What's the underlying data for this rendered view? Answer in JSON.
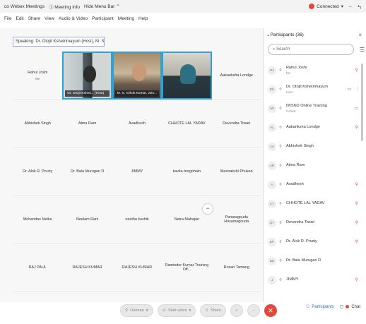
{
  "titlebar": {
    "app_name": "co Webex Meetings",
    "meeting_info": "ⓘ Meeting Info",
    "hide_menu": "Hide Menu Bar ⌃",
    "connected": "Connected",
    "conn_chevron": "▾",
    "minimize": "–",
    "restore": "ㄣ"
  },
  "menubar": [
    "File",
    "Edit",
    "Share",
    "View",
    "Audio & Video",
    "Participant",
    "Meeting",
    "Help"
  ],
  "speaking": "Speaking: Dr. Otojit Kshetrimayum (Host), M. S. Asho...",
  "grid": [
    [
      {
        "type": "text",
        "name": "Rahul Joshi",
        "sub": "Me"
      },
      {
        "type": "video",
        "label": "Dr. Otojit Ksheti... (Host)"
      },
      {
        "type": "video",
        "label": "M. S. Ashok Kumar, Join..."
      },
      {
        "type": "video",
        "label": ""
      },
      {
        "type": "text",
        "name": "Aakanksha Londge",
        "sub": ""
      }
    ],
    [
      {
        "type": "text",
        "name": "Abhishek Singh",
        "sub": ""
      },
      {
        "type": "text",
        "name": "Atma Ram",
        "sub": ""
      },
      {
        "type": "text",
        "name": "Avadhesh",
        "sub": ""
      },
      {
        "type": "text",
        "name": "CHHOTE LAL YADAV",
        "sub": ""
      },
      {
        "type": "text",
        "name": "Devendra Tiwari",
        "sub": ""
      }
    ],
    [
      {
        "type": "text",
        "name": "Dr. Alok R. Prusty",
        "sub": ""
      },
      {
        "type": "text",
        "name": "Dr. Bala Murugan D",
        "sub": ""
      },
      {
        "type": "text",
        "name": "JIMMY",
        "sub": ""
      },
      {
        "type": "text",
        "name": "kavita borgohain",
        "sub": ""
      },
      {
        "type": "text",
        "name": "Meenakshi Phukan",
        "sub": ""
      }
    ],
    [
      {
        "type": "text",
        "name": "Mohendas Netke",
        "sub": ""
      },
      {
        "type": "text",
        "name": "Neelam Rani",
        "sub": ""
      },
      {
        "type": "text",
        "name": "neetha koshik",
        "sub": ""
      },
      {
        "type": "text",
        "name": "Netra Mahajan",
        "sub": ""
      },
      {
        "type": "text",
        "name": "Panaragouda Hosamagouda",
        "sub": ""
      }
    ],
    [
      {
        "type": "text",
        "name": "RAJ PAUL",
        "sub": ""
      },
      {
        "type": "text",
        "name": "RAJESH KUMAR",
        "sub": ""
      },
      {
        "type": "text",
        "name": "RAJESH KUMAR",
        "sub": ""
      },
      {
        "type": "text",
        "name": "Raminder Kumar Training Off...",
        "sub": ""
      },
      {
        "type": "text",
        "name": "Rosan Tamang",
        "sub": ""
      }
    ]
  ],
  "minus_glyph": "−",
  "controls": {
    "unmute": "Unmute",
    "start_video": "Start video",
    "share": "Share",
    "more": "···",
    "leave": "✕",
    "participants": "Participants",
    "chat": "Chat",
    "caret": "▾",
    "mic_glyph": "⚲",
    "video_glyph": "▭",
    "share_glyph": "⇧",
    "reactions_glyph": "☺"
  },
  "panel": {
    "title": "Participants (36)",
    "close": "×",
    "search_placeholder": "Search",
    "menu_glyph": "☰",
    "participants": [
      {
        "initials": "RJ",
        "name": "Rahul Joshi",
        "role": "Me",
        "muted": true,
        "video": "",
        "extra": ""
      },
      {
        "initials": "DK",
        "name": "Dr. Otojit Kshetrimayum",
        "role": "Host",
        "muted": false,
        "video": "▭",
        "extra": "⁞"
      },
      {
        "initials": "IW",
        "name": "IWSNU Online Training",
        "role": "Cohost",
        "muted": false,
        "video": "▭",
        "extra": ""
      },
      {
        "initials": "AL",
        "name": "Aakanksha Londge",
        "role": "",
        "muted": true,
        "video": "",
        "extra": ""
      },
      {
        "initials": "AS",
        "name": "Abhishek Singh",
        "role": "",
        "muted": false,
        "video": "",
        "extra": ""
      },
      {
        "initials": "AR",
        "name": "Atma Ram",
        "role": "",
        "muted": false,
        "video": "",
        "extra": ""
      },
      {
        "initials": "A",
        "name": "Avadhesh",
        "role": "",
        "muted": true,
        "video": "",
        "extra": ""
      },
      {
        "initials": "CY",
        "name": "CHHOTE LAL YADAV",
        "role": "",
        "muted": true,
        "video": "",
        "extra": ""
      },
      {
        "initials": "DT",
        "name": "Devendra Tiwari",
        "role": "",
        "muted": true,
        "video": "",
        "extra": ""
      },
      {
        "initials": "DP",
        "name": "Dr. Alok R. Prusty",
        "role": "",
        "muted": true,
        "video": "",
        "extra": ""
      },
      {
        "initials": "DD",
        "name": "Dr. Bala Murugan D",
        "role": "",
        "muted": false,
        "video": "",
        "extra": ""
      },
      {
        "initials": "J",
        "name": "JIMMY",
        "role": "",
        "muted": true,
        "video": "",
        "extra": ""
      }
    ]
  },
  "colors": {
    "accent": "#2ba3d6",
    "danger": "#e1493b",
    "link": "#2a6fb8"
  }
}
